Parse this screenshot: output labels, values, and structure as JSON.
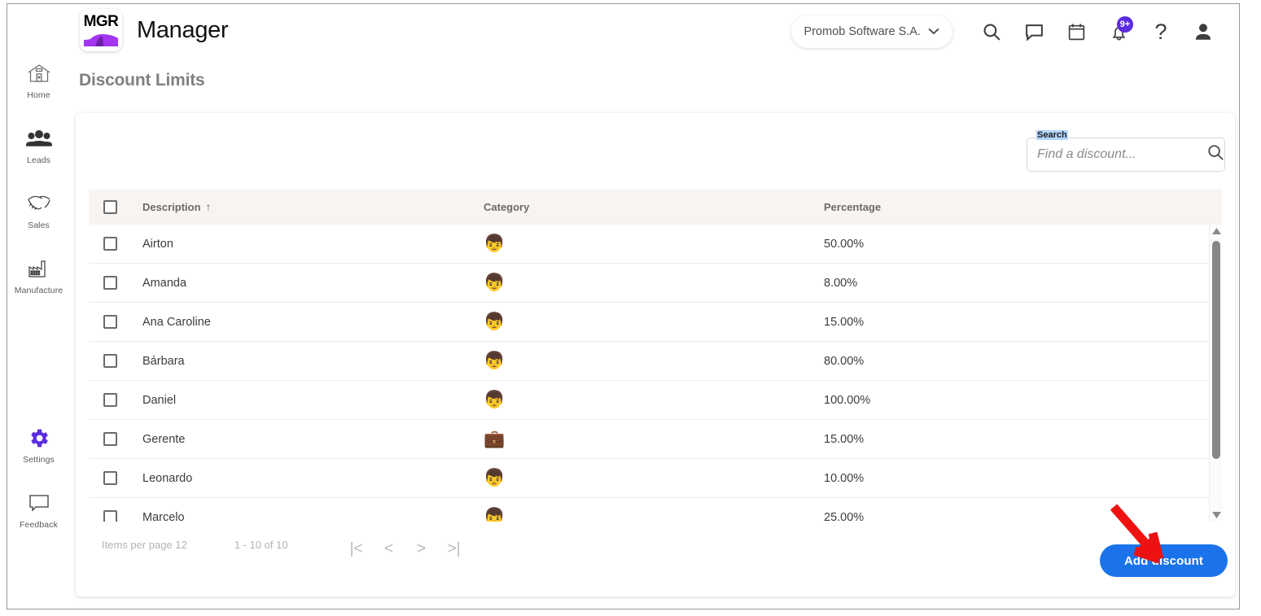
{
  "header": {
    "logo_text": "MGR",
    "logo_name": "mgr-logo",
    "brand_title": "Manager",
    "company": "Promob Software S.A.",
    "icons": [
      {
        "name": "search-icon",
        "label": "Search"
      },
      {
        "name": "chat-icon",
        "label": "Messages"
      },
      {
        "name": "calendar-icon",
        "label": "Calendar"
      },
      {
        "name": "bell-icon",
        "label": "Notifications",
        "badge": "9+"
      },
      {
        "name": "help-icon",
        "label": "?"
      },
      {
        "name": "user-avatar-icon",
        "label": "Account"
      }
    ],
    "badge_color": "#5b2be0"
  },
  "sidebar": {
    "items": [
      {
        "label": "Home",
        "icon": "home-icon",
        "active": false
      },
      {
        "label": "Leads",
        "icon": "people-icon",
        "active": false
      },
      {
        "label": "Sales",
        "icon": "handshake-icon",
        "active": false
      },
      {
        "label": "Manufacture",
        "icon": "factory-icon",
        "active": false
      },
      {
        "label": "Settings",
        "icon": "gear-icon",
        "active": true
      },
      {
        "label": "Feedback",
        "icon": "speech-bubble-icon",
        "active": false
      }
    ],
    "active_color": "#5b2be0"
  },
  "page": {
    "title": "Discount Limits"
  },
  "search": {
    "label": "Search",
    "placeholder": "Find a discount...",
    "value": "",
    "highlight_color": "#b4d5fe"
  },
  "table": {
    "columns": [
      {
        "key": "description",
        "label": "Description",
        "sorted": "asc",
        "sort_glyph": "↑"
      },
      {
        "key": "category",
        "label": "Category"
      },
      {
        "key": "percentage",
        "label": "Percentage"
      }
    ],
    "header_bg": "#f8f4f1",
    "rows": [
      {
        "checked": false,
        "description": "Airton",
        "category_icon": "child-face-emoji",
        "category_glyph": "👦",
        "percentage": "50.00%"
      },
      {
        "checked": false,
        "description": "Amanda",
        "category_icon": "child-face-emoji",
        "category_glyph": "👦",
        "percentage": "8.00%"
      },
      {
        "checked": false,
        "description": "Ana Caroline",
        "category_icon": "child-face-emoji",
        "category_glyph": "👦",
        "percentage": "15.00%"
      },
      {
        "checked": false,
        "description": "Bárbara",
        "category_icon": "child-face-emoji",
        "category_glyph": "👦",
        "percentage": "80.00%"
      },
      {
        "checked": false,
        "description": "Daniel",
        "category_icon": "child-face-emoji",
        "category_glyph": "👦",
        "percentage": "100.00%"
      },
      {
        "checked": false,
        "description": "Gerente",
        "category_icon": "briefcase-emoji",
        "category_glyph": "💼",
        "percentage": "15.00%"
      },
      {
        "checked": false,
        "description": "Leonardo",
        "category_icon": "child-face-emoji",
        "category_glyph": "👦",
        "percentage": "10.00%"
      },
      {
        "checked": false,
        "description": "Marcelo",
        "category_icon": "child-face-emoji",
        "category_glyph": "👦",
        "percentage": "25.00%"
      }
    ]
  },
  "footer": {
    "items_per_page_label": "Items per page",
    "items_per_page_value": "12",
    "range": "1 - 10 of 10",
    "pager": [
      {
        "name": "first-page-button",
        "glyph": "|<"
      },
      {
        "name": "prev-page-button",
        "glyph": "<"
      },
      {
        "name": "next-page-button",
        "glyph": ">"
      },
      {
        "name": "last-page-button",
        "glyph": ">|"
      }
    ],
    "add_button": "Add discount",
    "add_button_color": "#1a73ea"
  },
  "annotation": {
    "arrow_color": "#ee1111",
    "points_to": "add-discount-button"
  }
}
